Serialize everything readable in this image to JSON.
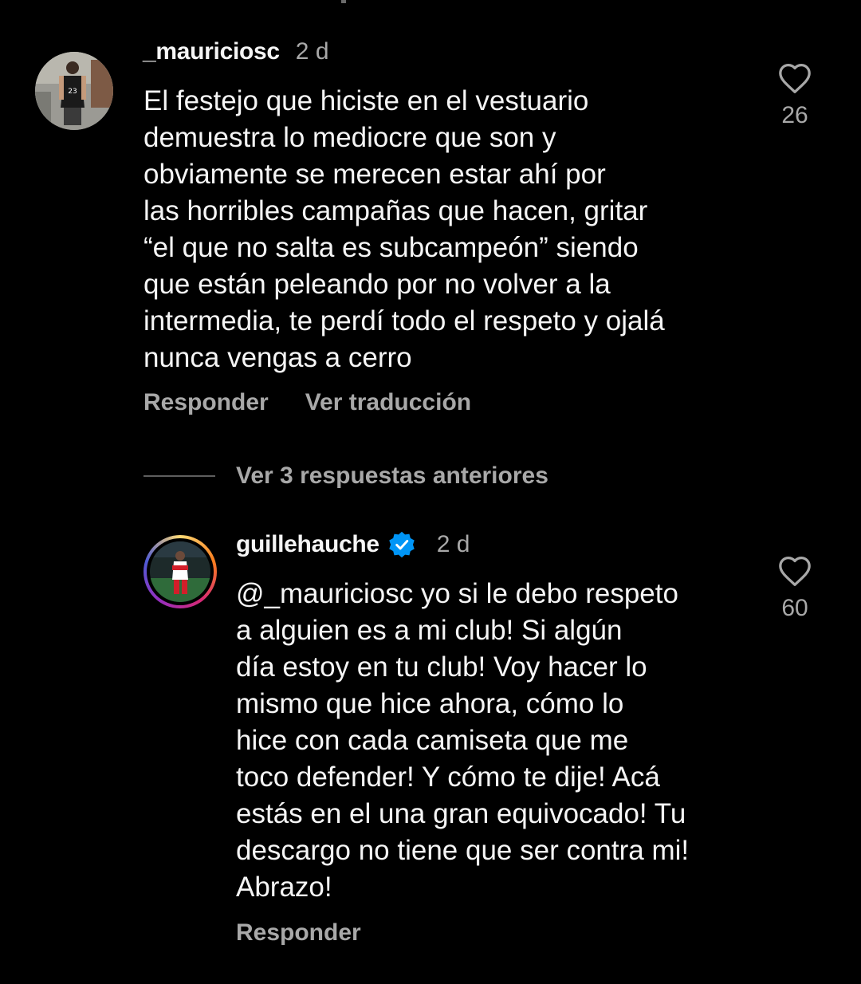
{
  "comments": [
    {
      "username": "_mauriciosc",
      "time": "2 d",
      "verified": false,
      "lines": [
        "El festejo que hiciste en el vestuario",
        "demuestra lo mediocre que son y",
        "obviamente se merecen estar ahí por",
        "las horribles campañas que hacen, gritar",
        "“el que no salta es subcampeón” siendo",
        "que están peleando por no volver a la",
        "intermedia, te perdí todo el respeto y ojalá",
        "nunca vengas a cerro"
      ],
      "reply_label": "Responder",
      "translate_label": "Ver traducción",
      "likes": "26"
    },
    {
      "username": "guillehauche",
      "time": "2 d",
      "verified": true,
      "lines": [
        "@_mauriciosc yo si le debo respeto",
        "a alguien es a mi club! Si algún",
        "día estoy en tu club! Voy hacer lo",
        "mismo que hice ahora, cómo lo",
        "hice con cada camiseta que me",
        "toco defender! Y cómo te dije! Acá",
        "estás en el una gran equivocado! Tu",
        "descargo no tiene que ser contra mi!",
        "Abrazo!"
      ],
      "reply_label": "Responder",
      "likes": "60"
    }
  ],
  "view_replies_label": "Ver 3 respuestas anteriores",
  "colors": {
    "background": "#000000",
    "primary_text": "#f5f5f5",
    "secondary_text": "#a8a8a8",
    "verified_badge": "#0095f6"
  },
  "icons": {
    "like": "heart-outline-icon",
    "verified": "verified-badge-icon"
  }
}
